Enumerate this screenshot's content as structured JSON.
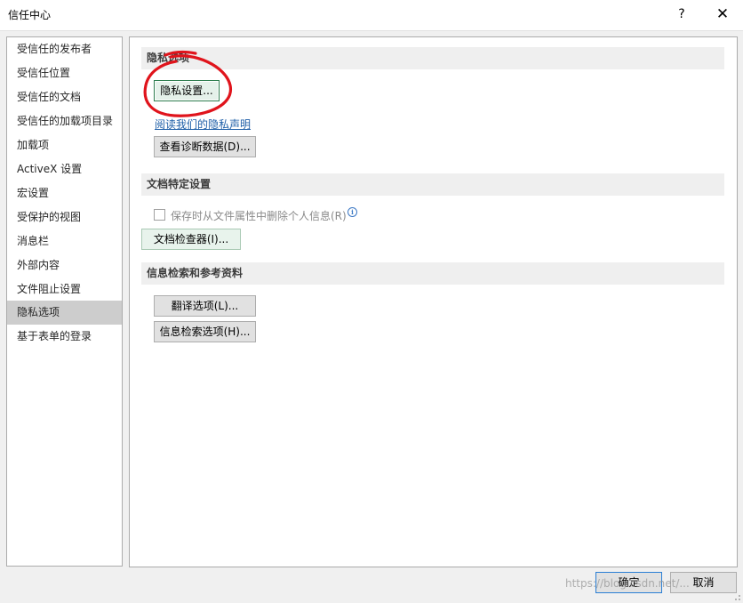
{
  "window": {
    "title": "信任中心",
    "help_label": "?",
    "close_label": "✕"
  },
  "sidebar": {
    "items": [
      {
        "label": "受信任的发布者"
      },
      {
        "label": "受信任位置"
      },
      {
        "label": "受信任的文档"
      },
      {
        "label": "受信任的加载项目录"
      },
      {
        "label": "加载项"
      },
      {
        "label": "ActiveX 设置"
      },
      {
        "label": "宏设置"
      },
      {
        "label": "受保护的视图"
      },
      {
        "label": "消息栏"
      },
      {
        "label": "外部内容"
      },
      {
        "label": "文件阻止设置"
      },
      {
        "label": "隐私选项"
      },
      {
        "label": "基于表单的登录"
      }
    ],
    "selected": "隐私选项"
  },
  "privacy": {
    "header": "隐私选项",
    "privacy_settings_button": "隐私设置...",
    "read_statement_link": "阅读我们的隐私声明",
    "diagnostic_button": "查看诊断数据(D)..."
  },
  "document_specific": {
    "header": "文档特定设置",
    "remove_personal_info_checkbox": "保存时从文件属性中删除个人信息(R)",
    "remove_personal_info_checked": false,
    "document_inspector_button": "文档检查器(I)..."
  },
  "research": {
    "header": "信息检索和参考资料",
    "translation_options_button": "翻译选项(L)...",
    "research_options_button": "信息检索选项(H)..."
  },
  "footer": {
    "ok_button": "确定",
    "cancel_button": "取消",
    "watermark": "https://blog.csdn.net/..."
  },
  "colors": {
    "annotation": "#e0141c",
    "link": "#1f5fa8",
    "selected_sidebar": "#cdcdcd"
  }
}
